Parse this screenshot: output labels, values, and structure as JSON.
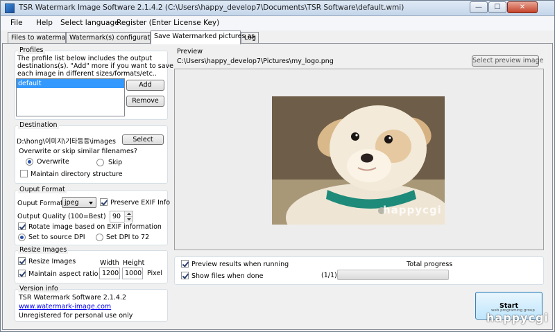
{
  "window": {
    "title": "TSR Watermark Image Software 2.1.4.2 (C:\\Users\\happy_develop7\\Documents\\TSR Software\\default.wmi)",
    "minimize_glyph": "—",
    "maximize_glyph": "☐",
    "close_glyph": "✕"
  },
  "menu": [
    "File",
    "Help",
    "Select language",
    "Register (Enter License Key)"
  ],
  "tabs": [
    "Files to watermark",
    "Watermark(s) configuration",
    "Save Watermarked pictures as",
    "Log"
  ],
  "profiles": {
    "legend": "Profiles",
    "description": [
      "The profile list below includes the output",
      "destinations(s). \"Add\" more if you want to save",
      "each image in different sizes/formats/etc.."
    ],
    "items": [
      "default"
    ],
    "add_label": "Add",
    "remove_label": "Remove"
  },
  "destination": {
    "legend": "Destination",
    "path": "D:\\hong\\이미지\\기타등등\\images",
    "select_label": "Select",
    "overwrite_question": "Overwrite or skip similar filenames?",
    "overwrite_label": "Overwrite",
    "skip_label": "Skip",
    "maintain_dir_label": "Maintain directory structure"
  },
  "output_format": {
    "legend": "Ouput Format",
    "format_label": "Ouput Format",
    "format_value": "jpeg",
    "preserve_exif_label": "Preserve EXIF Info",
    "quality_label": "Output Quality (100=Best)",
    "quality_value": "90",
    "rotate_label": "Rotate image based on EXIF information",
    "source_dpi_label": "Set to source DPI",
    "dpi72_label": "Set DPI to 72"
  },
  "resize": {
    "legend": "Resize Images",
    "resize_label": "Resize Images",
    "aspect_label": "Maintain aspect ratio",
    "width_label": "Width",
    "height_label": "Height",
    "width_value": "1200",
    "height_value": "1000",
    "unit_label": "Pixel"
  },
  "version": {
    "legend": "Version info",
    "name": "TSR Watermark Software 2.1.4.2",
    "url": "www.watermark-image.com",
    "license": "Unregistered for personal use only"
  },
  "preview": {
    "legend": "Preview",
    "path": "C:\\Users\\happy_develop7\\Pictures\\my_logo.png",
    "select_preview_label": "Select preview image",
    "photo_watermark": "happycgi"
  },
  "run": {
    "preview_results_label": "Preview results when running",
    "show_files_label": "Show files when done",
    "total_progress_label": "Total progress",
    "count": "(1/1)",
    "progress_fraction": 0,
    "start_label": "Start"
  },
  "corner_watermark": {
    "text": "happycgi",
    "sub": "web programing group"
  },
  "colors": {
    "selection": "#3399ff",
    "link": "#0000ee",
    "start_button": "#bee6fd",
    "collar": "#1e8a7a"
  }
}
